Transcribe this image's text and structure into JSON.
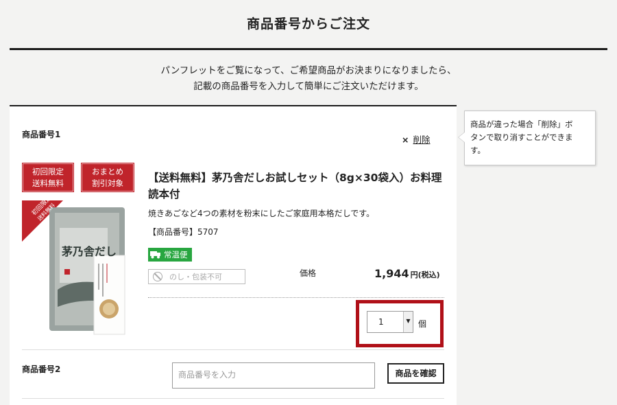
{
  "page": {
    "title": "商品番号からご注文",
    "intro_line1": "パンフレットをご覧になって、ご希望商品がお決まりになりましたら、",
    "intro_line2": "記載の商品番号を入力して簡単にご注文いただけます。"
  },
  "item1": {
    "label": "商品番号1",
    "delete_mark": "×",
    "delete_label": "削除",
    "badges": [
      {
        "line1": "初回限定",
        "line2": "送料無料"
      },
      {
        "line1": "おまとめ",
        "line2": "割引対象"
      }
    ],
    "image_ribbon_line1": "初回限定",
    "image_ribbon_line2": "送料無料",
    "package_name": "茅乃舎だし",
    "title": "【送料無料】茅乃舎だしお試しセット（8g×30袋入）お料理読本付",
    "description": "焼きあごなど4つの素材を粉末にしたご家庭用本格だしです。",
    "code_line": "【商品番号】5707",
    "ambient_label": "常温便",
    "noshi_label": "のし・包装不可",
    "price_label": "価格",
    "price": "1,944",
    "price_tax": "円(税込)",
    "quantity": "1",
    "quantity_unit": "個"
  },
  "item2": {
    "label": "商品番号2",
    "input_placeholder": "商品番号を入力",
    "confirm_label": "商品を確認"
  },
  "tooltip": {
    "line1": "商品が違った場合「削除」ボ",
    "line2": "タンで取り消すことができま",
    "line3": "す。"
  },
  "colors": {
    "badge_red": "#c0242b",
    "highlight_red": "#b01018",
    "ambient_green": "#28a640"
  }
}
